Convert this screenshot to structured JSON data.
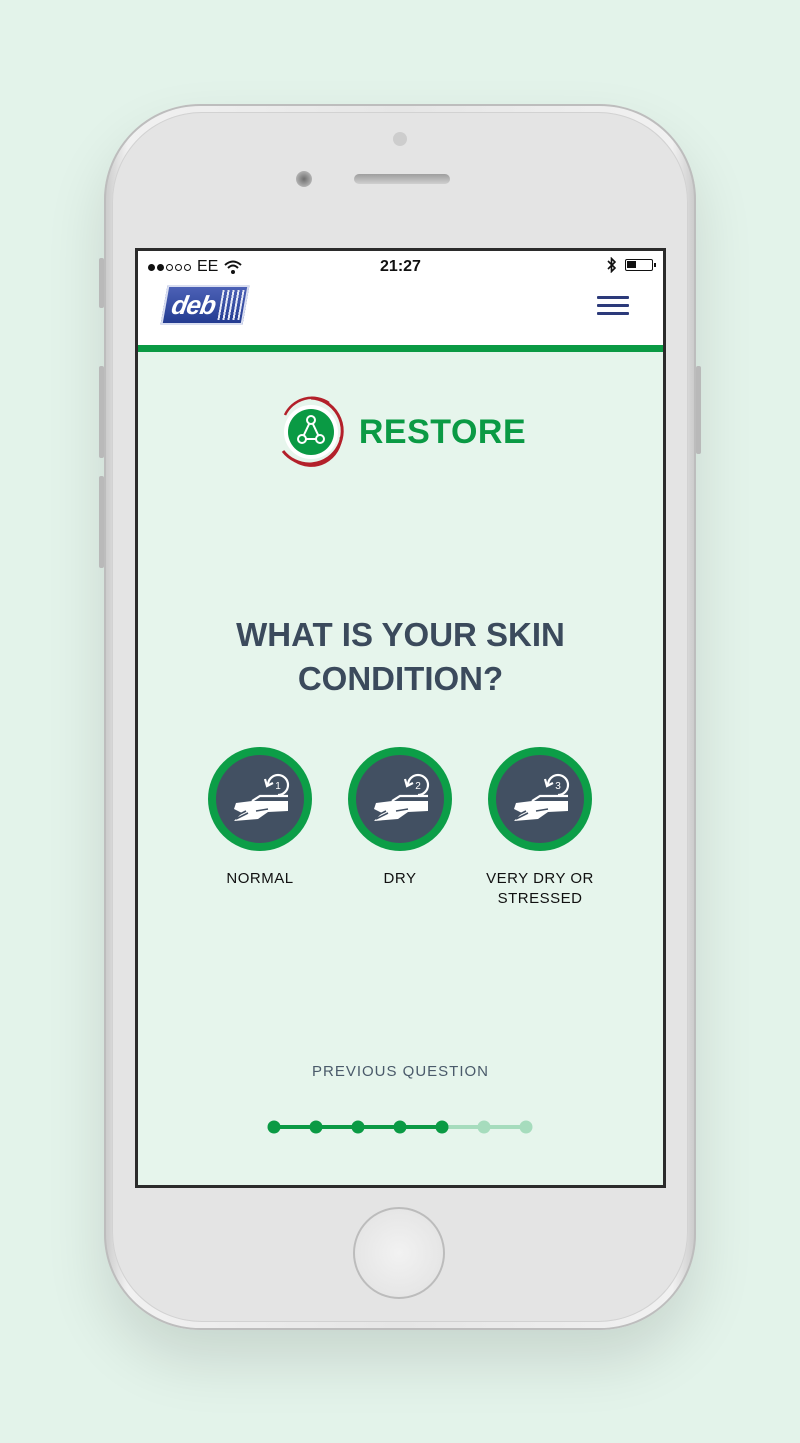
{
  "status_bar": {
    "carrier": "EE",
    "time": "21:27",
    "signal": [
      true,
      true,
      false,
      false,
      false
    ],
    "battery_level": 0.4
  },
  "header": {
    "logo_text": "deb",
    "menu_icon": "hamburger-menu-icon"
  },
  "brand": {
    "title": "RESTORE",
    "icon": "restore-triangle-icon"
  },
  "question": {
    "line1": "WHAT IS YOUR SKIN",
    "line2": "CONDITION?"
  },
  "options": [
    {
      "label": "NORMAL",
      "level": "1",
      "icon": "hand-care-icon"
    },
    {
      "label": "DRY",
      "level": "2",
      "icon": "hand-care-icon"
    },
    {
      "label_line1": "VERY DRY OR",
      "label_line2": "STRESSED",
      "level": "3",
      "icon": "hand-care-icon"
    }
  ],
  "previous_label": "PREVIOUS QUESTION",
  "progress": {
    "total": 7,
    "completed": 5
  },
  "colors": {
    "brand_green": "#0a9a44",
    "progress_inactive": "#a6dcbd",
    "option_fill": "#425062",
    "question_text": "#3b4a5c",
    "screen_bg": "#e6f5ec",
    "logo_blue": "#223a8f",
    "brand_red": "#b3202a"
  }
}
